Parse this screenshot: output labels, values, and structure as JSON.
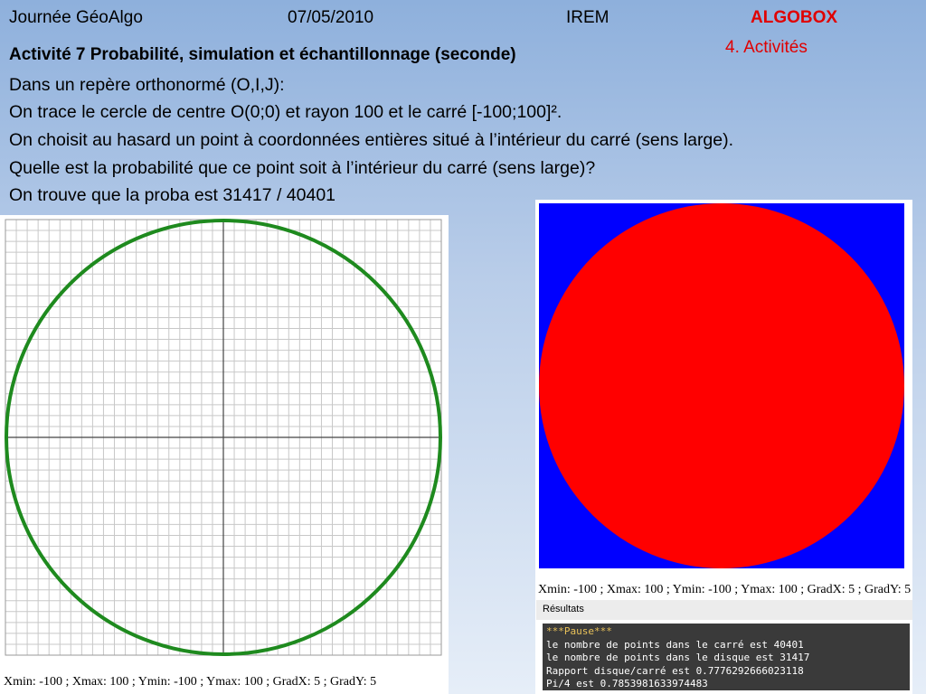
{
  "header": {
    "event": "Journée GéoAlgo",
    "date": "07/05/2010",
    "org": "IREM",
    "brand": "ALGOBOX",
    "section": "4. Activités"
  },
  "activity": {
    "title": "Activité 7  Probabilité, simulation et échantillonnage (seconde)",
    "lines": [
      "Dans un repère orthonormé (O,I,J):",
      "On trace le cercle de centre O(0;0) et rayon 100 et le carré [-100;100]².",
      "On choisit au hasard un point à coordonnées entières situé à l’intérieur du carré (sens large).",
      "Quelle est la probabilité que ce point soit à l’intérieur du carré (sens large)?",
      "On trouve que la proba est 31417 / 40401"
    ]
  },
  "left_graph": {
    "caption": "Xmin: -100 ; Xmax: 100 ; Ymin: -100 ; Ymax: 100 ; GradX: 5 ; GradY: 5",
    "circle_color": "#1e8a1e"
  },
  "right_graph": {
    "caption": "Xmin: -100 ; Xmax: 100 ; Ymin: -100 ; Ymax: 100 ; GradX: 5 ; GradY: 5",
    "square_color": "#0000ff",
    "disk_color": "#ff0000"
  },
  "results": {
    "label": "Résultats",
    "lines": [
      "***Pause***",
      "le nombre de points dans le carré est 40401",
      "le nombre de points dans le disque est 31417",
      "Rapport disque/carré est 0.7776292666023118",
      "Pi/4  est 0.7853981633974483"
    ]
  }
}
